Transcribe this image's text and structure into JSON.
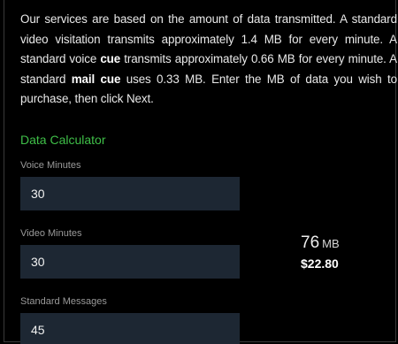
{
  "intro": {
    "part1": "Our services are based on the amount of data transmitted. A standard video visitation transmits approximately 1.4 MB for every minute. A standard voice ",
    "keyword1": "cue",
    "part2": " transmits approximately 0.66 MB for every minute. A standard ",
    "keyword2": "mail cue",
    "part3": " uses 0.33 MB. Enter the MB of data you wish to purchase, then click Next."
  },
  "calculator": {
    "title": "Data Calculator",
    "fields": [
      {
        "label": "Voice Minutes",
        "value": "30"
      },
      {
        "label": "Video Minutes",
        "value": "30"
      },
      {
        "label": "Standard Messages",
        "value": "45"
      }
    ],
    "total_mb": "76",
    "mb_unit": "MB",
    "total_price": "$22.80"
  },
  "colors": {
    "accent": "#3fbf48",
    "input_bg": "#1d2733",
    "background": "#000000"
  }
}
